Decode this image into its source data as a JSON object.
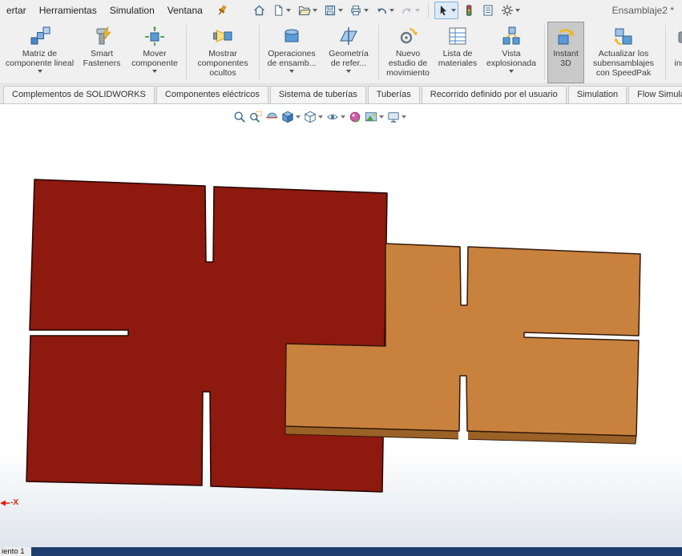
{
  "window": {
    "title": "Ensamblaje2 *"
  },
  "menubar": {
    "items": [
      "ertar",
      "Herramientas",
      "Simulation",
      "Ventana"
    ]
  },
  "ribbon": {
    "buttons": [
      {
        "label": "Matriz de\ncomponente lineal",
        "dropdown": true
      },
      {
        "label": "Smart\nFasteners",
        "dropdown": false
      },
      {
        "label": "Mover\ncomponente",
        "dropdown": true
      },
      {
        "label": "Mostrar\ncomponentes\nocultos",
        "dropdown": false
      },
      {
        "label": "Operaciones\nde ensamb...",
        "dropdown": true
      },
      {
        "label": "Geometría\nde refer...",
        "dropdown": true
      },
      {
        "label": "Nuevo\nestudio de\nmovimiento",
        "dropdown": false
      },
      {
        "label": "Lista de\nmateriales",
        "dropdown": false
      },
      {
        "label": "Vista\nexplosionada",
        "dropdown": true
      },
      {
        "label": "Instant\n3D",
        "dropdown": false,
        "selected": true
      },
      {
        "label": "Actualizar los\nsubensamblajes\ncon SpeedPak",
        "dropdown": false
      },
      {
        "label": "To\ninsta...",
        "dropdown": false
      }
    ]
  },
  "command_tabs": [
    "Complementos de SOLIDWORKS",
    "Componentes eléctricos",
    "Sistema de tuberías",
    "Tuberías",
    "Recorrido definido por el usuario",
    "Simulation",
    "Flow Simula..."
  ],
  "viewport": {
    "triad_x_label": "-X"
  },
  "statusbar": {
    "motion_tab_label": "iento 1"
  },
  "colors": {
    "board_red": "#8e190e",
    "board_wood": "#c9823e",
    "board_wood_edge": "#9a6227",
    "statusbar_blue": "#1e3e70"
  }
}
